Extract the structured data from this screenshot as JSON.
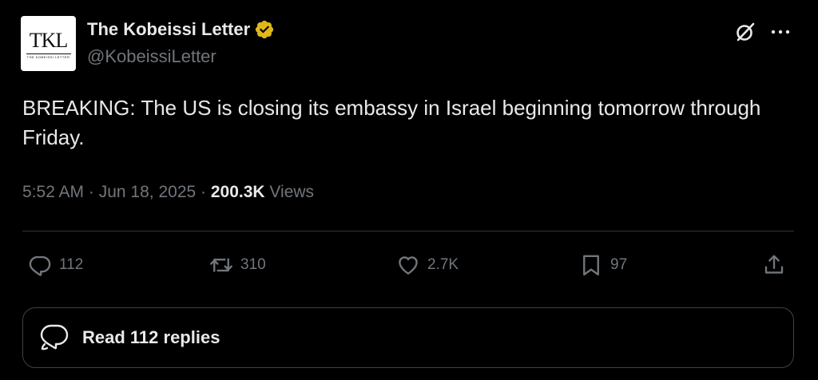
{
  "author": {
    "avatar_monogram": "TKL",
    "avatar_caption": "THE KOBEISSI LETTER",
    "display_name": "The Kobeissi Letter",
    "handle": "@KobeissiLetter",
    "verified_color": "#e2b719"
  },
  "tweet": {
    "text": "BREAKING: The US is closing its embassy in Israel beginning tomorrow through Friday.",
    "time": "5:52 AM",
    "separator": " · ",
    "date": "Jun 18, 2025",
    "views_count": "200.3K",
    "views_label": " Views"
  },
  "actions": {
    "replies": "112",
    "reposts": "310",
    "likes": "2.7K",
    "bookmarks": "97"
  },
  "read_replies_label": "Read 112 replies",
  "icons": [
    "verified-badge-icon",
    "grok-icon",
    "more-icon",
    "reply-icon",
    "repost-icon",
    "like-icon",
    "bookmark-icon",
    "share-icon",
    "chat-bubbles-icon"
  ]
}
